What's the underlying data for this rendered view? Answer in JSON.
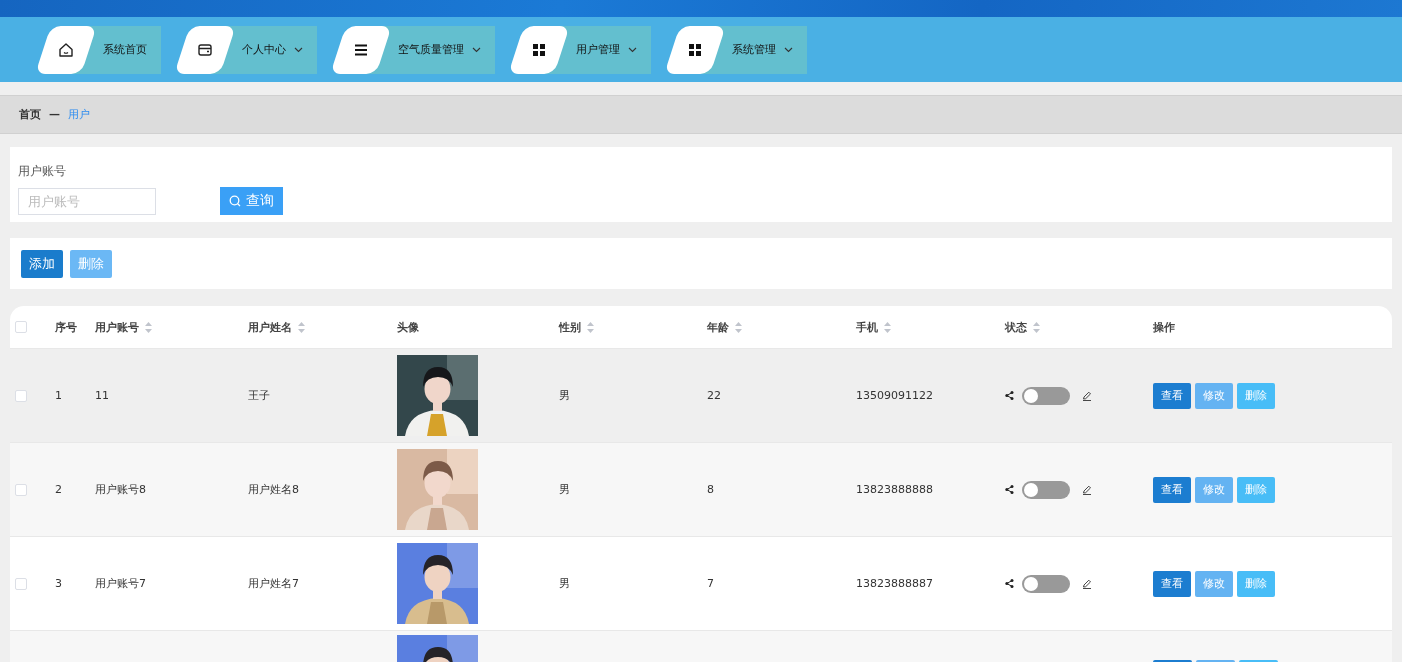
{
  "nav": [
    {
      "label": "系统首页",
      "has_menu": false
    },
    {
      "label": "个人中心",
      "has_menu": true
    },
    {
      "label": "空气质量管理",
      "has_menu": true
    },
    {
      "label": "用户管理",
      "has_menu": true
    },
    {
      "label": "系统管理",
      "has_menu": true
    }
  ],
  "breadcrumb": {
    "items": [
      "首页",
      "用户"
    ],
    "separator": "—"
  },
  "search": {
    "label": "用户账号",
    "placeholder": "用户账号",
    "button": "查询"
  },
  "toolbar": [
    {
      "label": "添加",
      "kind": "add"
    },
    {
      "label": "删除",
      "kind": "delete"
    }
  ],
  "table": {
    "all_checked": false,
    "columns": [
      {
        "label": "序号",
        "sortable": false
      },
      {
        "label": "用户账号",
        "sortable": true
      },
      {
        "label": "用户姓名",
        "sortable": true
      },
      {
        "label": "头像",
        "sortable": false
      },
      {
        "label": "性别",
        "sortable": true
      },
      {
        "label": "年龄",
        "sortable": true
      },
      {
        "label": "手机",
        "sortable": true
      },
      {
        "label": "状态",
        "sortable": true
      },
      {
        "label": "操作",
        "sortable": false
      }
    ],
    "rows": [
      {
        "kind": "full",
        "checked": false,
        "index": "1",
        "account": "11",
        "name": "王子",
        "avatar": {
          "kind": "picture"
        },
        "gender": "男",
        "age": "22",
        "phone": "13509091122",
        "on": false,
        "actions": [
          {
            "label": "查看",
            "kind": "view"
          },
          {
            "label": "修改",
            "kind": "edit"
          },
          {
            "label": "删除",
            "kind": "delete"
          }
        ]
      },
      {
        "kind": "full",
        "checked": false,
        "index": "2",
        "account": "用户账号8",
        "name": "用户姓名8",
        "avatar": {
          "kind": "picture"
        },
        "gender": "男",
        "age": "8",
        "phone": "13823888888",
        "on": false,
        "actions": [
          {
            "label": "查看",
            "kind": "view"
          },
          {
            "label": "修改",
            "kind": "edit"
          },
          {
            "label": "删除",
            "kind": "delete"
          }
        ]
      },
      {
        "kind": "full",
        "checked": false,
        "index": "3",
        "account": "用户账号7",
        "name": "用户姓名7",
        "avatar": {
          "kind": "picture"
        },
        "gender": "男",
        "age": "7",
        "phone": "13823888887",
        "on": false,
        "actions": [
          {
            "label": "查看",
            "kind": "view"
          },
          {
            "label": "修改",
            "kind": "edit"
          },
          {
            "label": "删除",
            "kind": "delete"
          }
        ]
      },
      {
        "kind": "cut",
        "avatar": {
          "kind": "picture"
        },
        "actions": [
          {
            "kind": "view"
          },
          {
            "kind": "edit"
          },
          {
            "kind": "delete"
          }
        ]
      }
    ]
  }
}
